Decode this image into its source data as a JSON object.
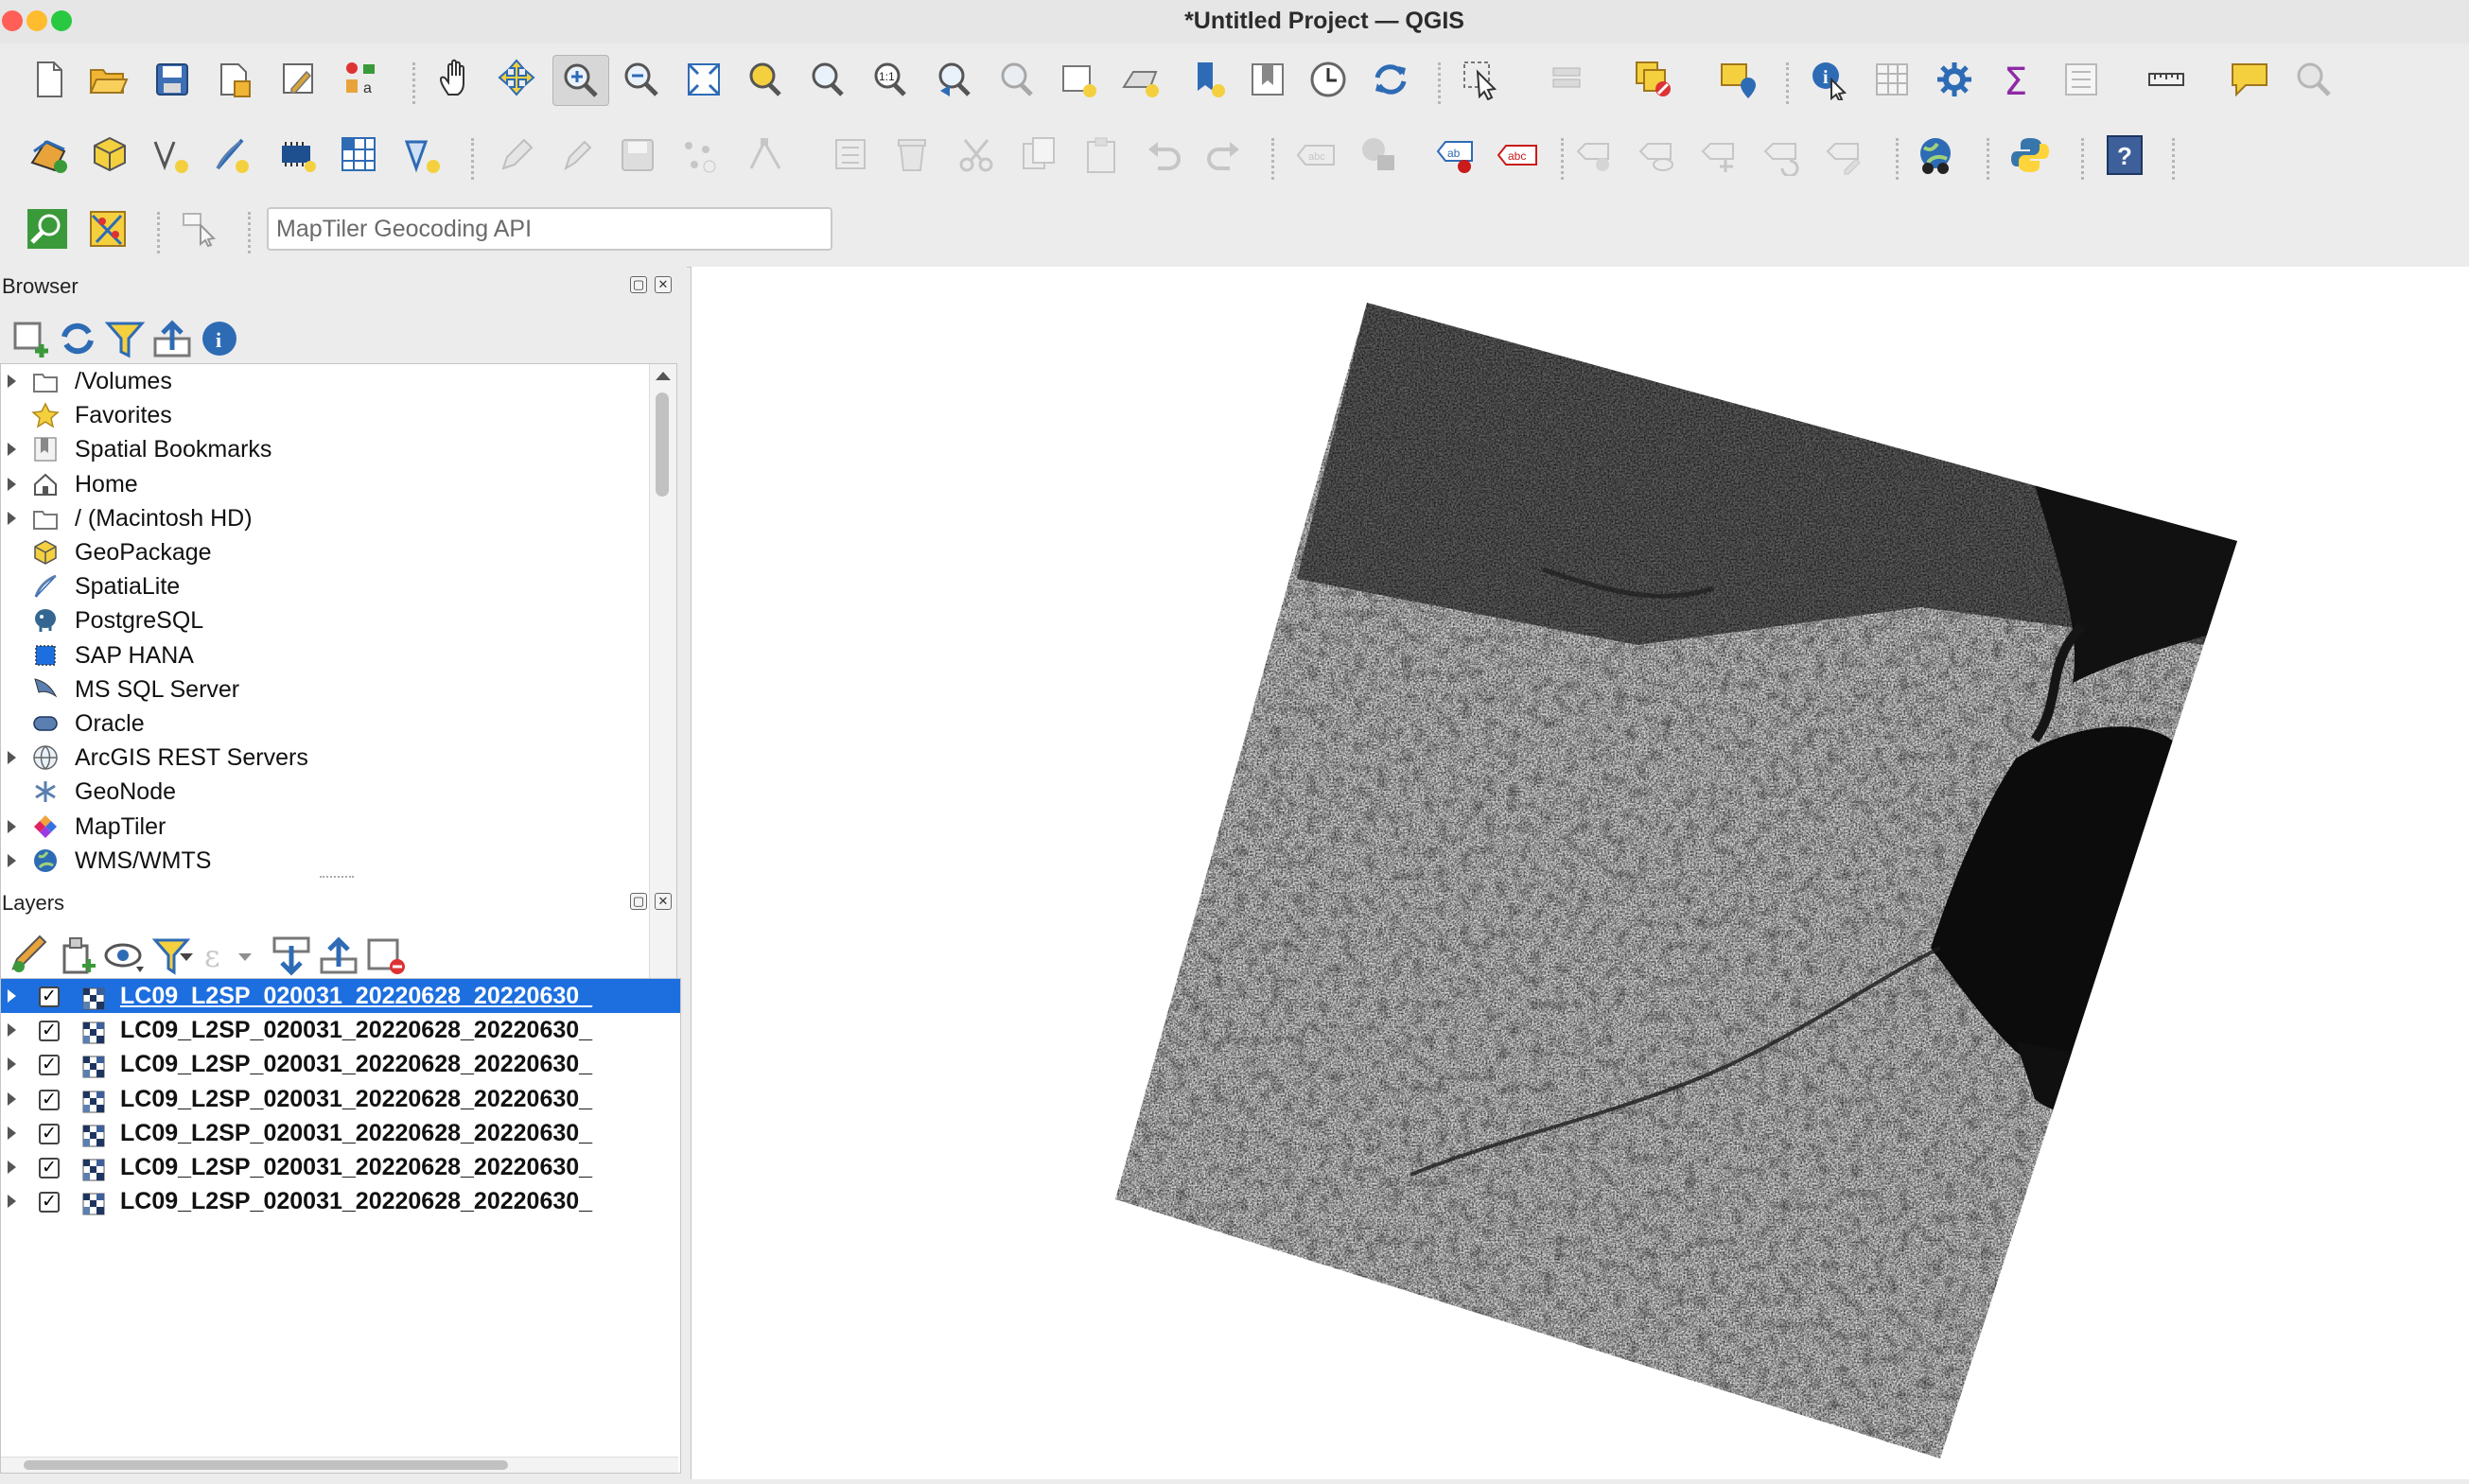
{
  "window": {
    "title": "*Untitled Project — QGIS",
    "traffic_lights": {
      "close": "#ff5f57",
      "minimize": "#febc2e",
      "zoom": "#28c840"
    }
  },
  "toolbar_row1": {
    "icons": [
      "new-project-icon",
      "open-project-icon",
      "save-project-icon",
      "save-as-icon",
      "print-layout-icon",
      "style-manager-icon",
      "pan-map-icon",
      "pan-to-selection-icon",
      "zoom-in-icon",
      "zoom-out-icon",
      "zoom-full-icon",
      "zoom-to-selection-icon",
      "zoom-to-layer-icon",
      "zoom-native-resolution-icon",
      "zoom-last-icon",
      "zoom-next-icon",
      "new-map-view-icon",
      "new-3d-map-view-icon",
      "new-spatial-bookmark-icon",
      "show-bookmarks-icon",
      "temporal-controller-icon",
      "refresh-icon",
      "select-features-icon",
      "select-by-value-icon",
      "deselect-features-icon",
      "select-location-icon",
      "identify-features-icon",
      "attribute-table-icon",
      "processing-toolbox-icon",
      "statistical-summary-icon",
      "open-field-calculator-icon",
      "measure-line-icon",
      "map-tips-icon",
      "locator-icon"
    ]
  },
  "toolbar_row2": {
    "icons": [
      "data-source-manager-icon",
      "new-geopackage-layer-icon",
      "new-shapefile-layer-icon",
      "new-spatialite-layer-icon",
      "new-temporary-scratch-layer-icon",
      "new-virtual-layer-icon",
      "new-mesh-layer-icon",
      "toggle-editing-icon",
      "current-edits-icon",
      "save-layer-edits-icon",
      "add-feature-icon",
      "vertex-tool-icon",
      "modify-attributes-icon",
      "delete-selected-icon",
      "cut-features-icon",
      "copy-features-icon",
      "paste-features-icon",
      "undo-icon",
      "redo-icon",
      "label-toolbar-icon",
      "layer-diagram-icon",
      "highlight-pinned-labels-icon",
      "toggle-label-display-icon",
      "pin-labels-icon",
      "show-hide-labels-icon",
      "move-label-icon",
      "rotate-label-icon",
      "change-label-properties-icon",
      "plugin-manager-icon",
      "python-console-icon",
      "help-icon"
    ]
  },
  "toolbar_row3": {
    "icons": [
      "search-locator-icon",
      "georeferencer-icon",
      "identify-geocoding-icon"
    ],
    "geocoding_placeholder": "MapTiler Geocoding API"
  },
  "browser": {
    "title": "Browser",
    "toolbar_icons": [
      "add-selected-layers-icon",
      "refresh-icon",
      "filter-browser-icon",
      "collapse-all-icon",
      "enable-properties-icon"
    ],
    "items": [
      {
        "label": "/Volumes",
        "icon": "folder-icon",
        "expandable": true
      },
      {
        "label": "Favorites",
        "icon": "star-icon",
        "expandable": false
      },
      {
        "label": "Spatial Bookmarks",
        "icon": "bookmark-icon",
        "expandable": true
      },
      {
        "label": "Home",
        "icon": "home-icon",
        "expandable": true
      },
      {
        "label": "/ (Macintosh HD)",
        "icon": "folder-icon",
        "expandable": true
      },
      {
        "label": "GeoPackage",
        "icon": "geopackage-icon",
        "expandable": false
      },
      {
        "label": "SpatiaLite",
        "icon": "spatialite-icon",
        "expandable": false
      },
      {
        "label": "PostgreSQL",
        "icon": "postgresql-icon",
        "expandable": false
      },
      {
        "label": "SAP HANA",
        "icon": "sap-hana-icon",
        "expandable": false
      },
      {
        "label": "MS SQL Server",
        "icon": "mssql-icon",
        "expandable": false
      },
      {
        "label": "Oracle",
        "icon": "oracle-icon",
        "expandable": false
      },
      {
        "label": "ArcGIS REST Servers",
        "icon": "arcgis-globe-icon",
        "expandable": true
      },
      {
        "label": "GeoNode",
        "icon": "geonode-icon",
        "expandable": false
      },
      {
        "label": "MapTiler",
        "icon": "maptiler-icon",
        "expandable": true
      },
      {
        "label": "WMS/WMTS",
        "icon": "wms-globe-icon",
        "expandable": true
      }
    ]
  },
  "layers": {
    "title": "Layers",
    "toolbar_icons": [
      "open-layer-styling-icon",
      "add-group-icon",
      "manage-map-themes-icon",
      "filter-legend-icon",
      "filter-by-expression-icon",
      "expand-all-icon",
      "collapse-all-icon",
      "remove-layer-icon"
    ],
    "items": [
      {
        "label": "LC09_L2SP_020031_20220628_20220630_",
        "checked": true,
        "selected": true
      },
      {
        "label": "LC09_L2SP_020031_20220628_20220630_",
        "checked": true,
        "selected": false
      },
      {
        "label": "LC09_L2SP_020031_20220628_20220630_",
        "checked": true,
        "selected": false
      },
      {
        "label": "LC09_L2SP_020031_20220628_20220630_",
        "checked": true,
        "selected": false
      },
      {
        "label": "LC09_L2SP_020031_20220628_20220630_",
        "checked": true,
        "selected": false
      },
      {
        "label": "LC09_L2SP_020031_20220628_20220630_",
        "checked": true,
        "selected": false
      },
      {
        "label": "LC09_L2SP_020031_20220628_20220630_",
        "checked": true,
        "selected": false
      }
    ],
    "checkmark": "✓"
  },
  "map_canvas": {
    "content": "raster-scene",
    "colors": {
      "highlight": "#1d6fe0",
      "background": "#ffffff"
    }
  }
}
